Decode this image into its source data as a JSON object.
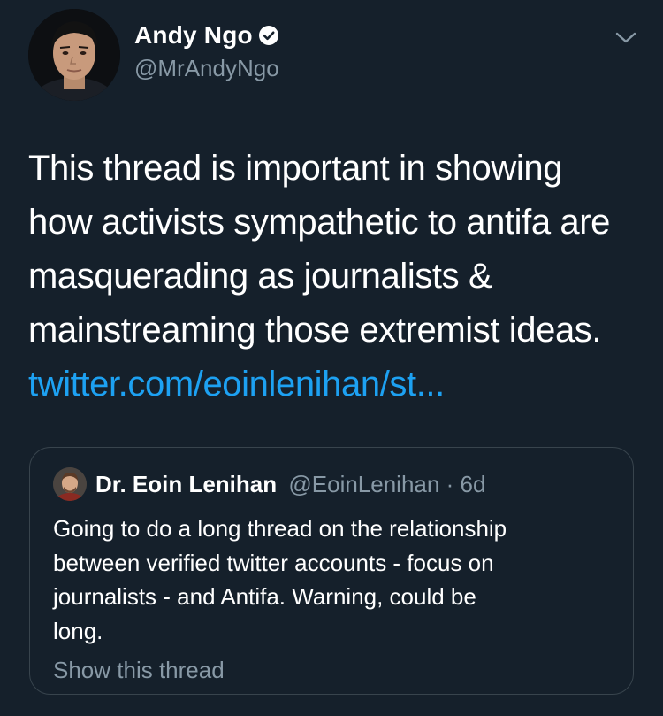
{
  "tweet": {
    "author_name": "Andy Ngo",
    "author_handle": "@MrAndyNgo",
    "verified": true,
    "text_lines": [
      "This thread is important in showing",
      "how activists sympathetic to antifa are",
      "masquerading as journalists &",
      "mainstreaming those extremist ideas."
    ],
    "link_text": "twitter.com/eoinlenihan/st..."
  },
  "quoted_tweet": {
    "author_name": "Dr. Eoin Lenihan",
    "author_handle": "@EoinLenihan",
    "separator": "·",
    "time_ago": "6d",
    "text_lines": [
      "Going to do a long thread on the relationship",
      "between verified twitter accounts - focus on",
      "journalists - and Antifa. Warning, could be",
      "long."
    ],
    "show_thread_label": "Show this thread"
  },
  "colors": {
    "background": "#15202b",
    "primary_text": "#ffffff",
    "secondary_text": "#8899a6",
    "link": "#1da1f2",
    "border": "#38444d"
  },
  "icons": {
    "verified": "verified-badge-icon",
    "menu": "chevron-down-icon"
  }
}
